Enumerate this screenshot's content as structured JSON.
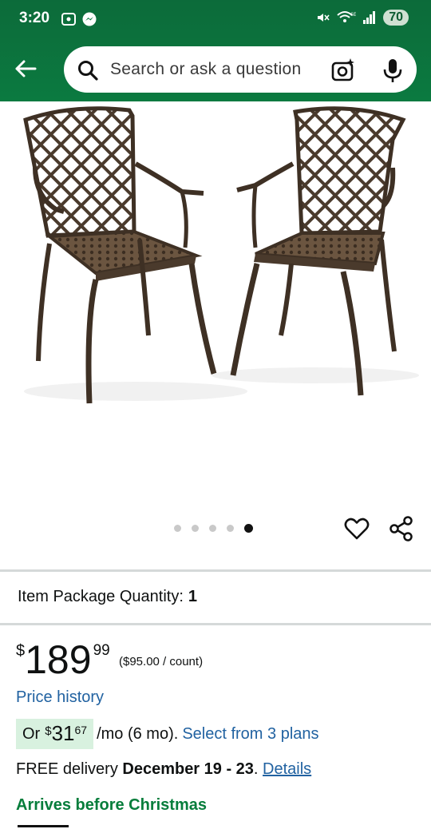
{
  "status_bar": {
    "time": "3:20",
    "battery": "70",
    "icons": [
      "screenshot-icon",
      "messenger-icon",
      "mute-icon",
      "wifi-6e-icon",
      "signal-icon"
    ]
  },
  "header": {
    "search_placeholder": "Search or ask a question",
    "icons": [
      "back-arrow-icon",
      "search-icon",
      "camera-icon",
      "mic-icon"
    ],
    "background": "#0b7a40"
  },
  "gallery": {
    "image_count": 5,
    "active_index": 4,
    "icons": [
      "heart-icon",
      "share-icon"
    ]
  },
  "product": {
    "quantity_label": "Item Package Quantity:",
    "quantity_value": "1",
    "price_symbol": "$",
    "price_whole": "189",
    "price_fraction": "99",
    "unit_price": "($95.00 / count)",
    "price_history": "Price history",
    "installment": {
      "or": "Or",
      "symbol": "$",
      "whole": "31",
      "fraction": "67",
      "term": "/mo (6 mo).",
      "plans_link": "Select from 3 plans"
    },
    "delivery": {
      "prefix": "FREE delivery",
      "date": "December 19 - 23",
      "period": ".",
      "details_link": "Details"
    },
    "arrives": "Arrives before Christmas"
  },
  "colors": {
    "link": "#2162a1",
    "arrives_green": "#067d3b",
    "installment_bg": "#d8f1df"
  }
}
